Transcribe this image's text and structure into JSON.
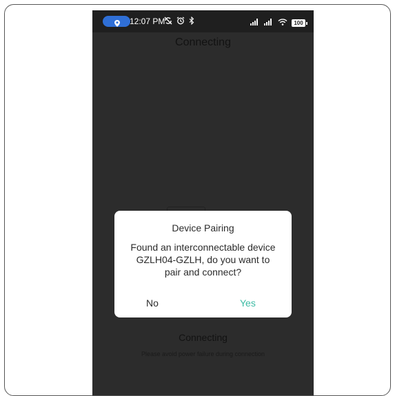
{
  "statusbar": {
    "time": "12:07 PM",
    "location_icon": "location-pin-icon",
    "left_icons": [
      "sync-off-icon",
      "alarm-icon",
      "bluetooth-icon"
    ],
    "right_icons": [
      "signal-1-icon",
      "signal-2-icon",
      "wifi-icon"
    ],
    "battery_level": "100",
    "pill_color": "#2f6fd6"
  },
  "screen": {
    "top_title": "Connecting",
    "bottom_title": "Connecting",
    "bottom_note": "Please avoid power failure during connection"
  },
  "dialog": {
    "title": "Device Pairing",
    "message": "Found an interconnectable device GZLH04-GZLH, do you want to pair and connect?",
    "no_label": "No",
    "yes_label": "Yes",
    "yes_color": "#3cbba4"
  }
}
